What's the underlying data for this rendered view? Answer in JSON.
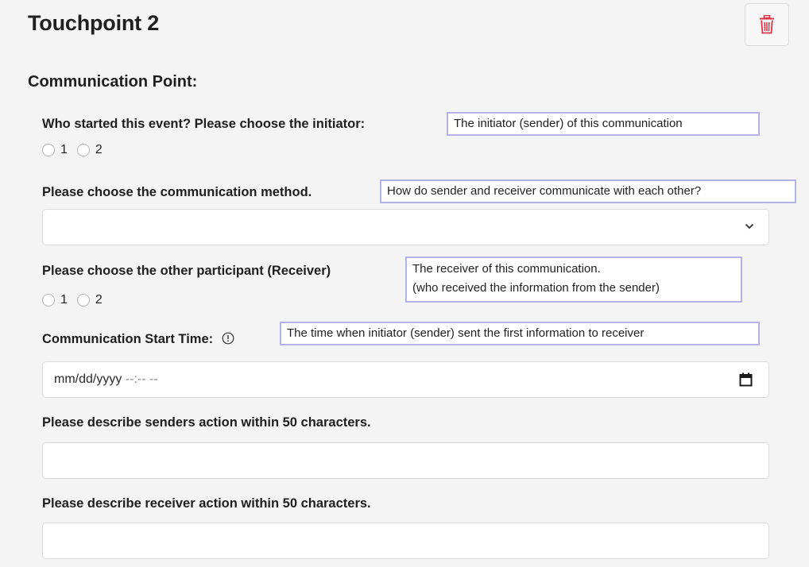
{
  "header": {
    "title": "Touchpoint 2"
  },
  "section": {
    "heading": "Communication Point:"
  },
  "initiator": {
    "label": "Who started this event? Please choose the initiator:",
    "hint": "The initiator (sender) of this communication",
    "options": [
      "1",
      "2"
    ]
  },
  "method": {
    "label": "Please choose the communication method.",
    "hint": "How do sender and receiver communicate with each other?",
    "selected_value": ""
  },
  "receiver": {
    "label": "Please choose the other participant (Receiver)",
    "hint_line1": "The receiver of this communication.",
    "hint_line2": "(who received the information from the sender)",
    "options": [
      "1",
      "2"
    ]
  },
  "start_time": {
    "label": "Communication Start Time:",
    "hint": "The time when initiator (sender) sent the first information to receiver",
    "placeholder_date": "mm/dd/yyyy",
    "placeholder_time": "--:-- --"
  },
  "sender_action": {
    "label": "Please describe senders action within 50 characters.",
    "value": ""
  },
  "receiver_action": {
    "label": "Please describe receiver action within 50 characters.",
    "value": ""
  },
  "icons": {
    "delete": "trash-icon",
    "select": "chevron-down-icon",
    "calendar": "calendar-icon",
    "info": "info-icon"
  },
  "colors": {
    "delete_icon": "#dc3545",
    "hint_border": "#b3b3e8",
    "background": "#f4f4f4"
  }
}
